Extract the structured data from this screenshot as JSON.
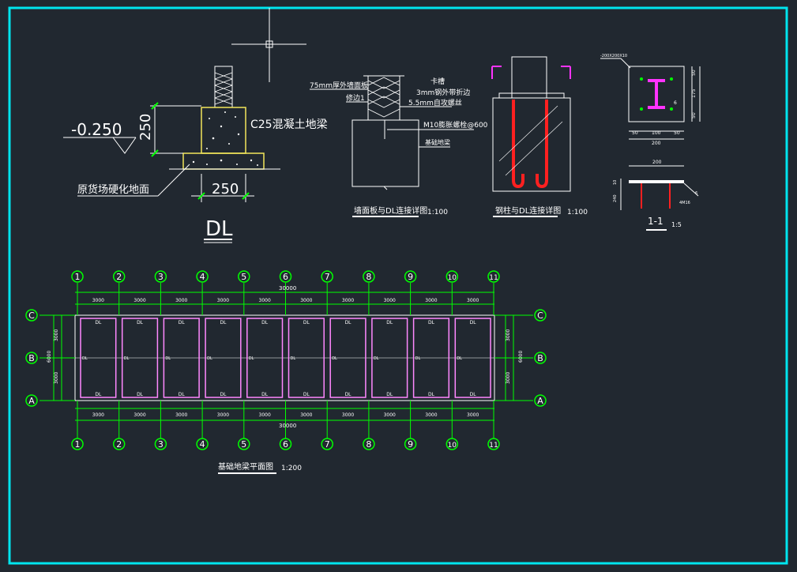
{
  "colors": {
    "background": "#212830",
    "frame": "#00e5ee",
    "line": "#ffffff",
    "dim_green": "#00ff00",
    "concrete_yellow": "#f2e65a",
    "steel_magenta": "#ff33ff",
    "beam_pink": "#ff88ff",
    "rebar_red": "#ff2020"
  },
  "dl_section": {
    "elevation": "-0.250",
    "height_dim": "250",
    "width_dim": "250",
    "beam_label": "C25混凝土地梁",
    "ground_label": "原货场硬化地面",
    "title": "DL"
  },
  "wall_detail": {
    "note1": "75mm厚外墙面板",
    "note2": "卡槽",
    "note3": "3mm钢外带折边",
    "note4": "修边1",
    "note5": "5.5mm自攻螺丝",
    "note6": "M10膨胀螺栓@600",
    "note7": "基础地梁",
    "title": "墙面板与DL连接详图",
    "scale": "1:100"
  },
  "column_detail": {
    "title": "钢柱与DL连接详图",
    "scale": "1:100"
  },
  "plate_detail": {
    "leader": "-200X200X10",
    "dims_bottom": [
      "50",
      "100",
      "50"
    ],
    "total_bottom": "200",
    "dims_right": [
      "50",
      "175",
      "50"
    ],
    "weld": "6",
    "sec_top": "200",
    "sec_left": "10",
    "sec_height": "240",
    "sec_anchor": "4M16",
    "sec_weld": "6",
    "title": "1-1",
    "scale": "1:5"
  },
  "plan": {
    "col_axes": [
      "1",
      "2",
      "3",
      "4",
      "5",
      "6",
      "7",
      "8",
      "9",
      "10",
      "11"
    ],
    "row_axes": [
      "C",
      "B",
      "A"
    ],
    "bay_dims": [
      "3000",
      "3000",
      "3000",
      "3000",
      "3000",
      "3000",
      "3000",
      "3000",
      "3000",
      "3000"
    ],
    "total_dim": "30000",
    "side_dims": [
      "3000",
      "3000"
    ],
    "side_total": "6000",
    "beam_tag": "DL",
    "title": "基础地梁平面图",
    "scale": "1:200"
  }
}
